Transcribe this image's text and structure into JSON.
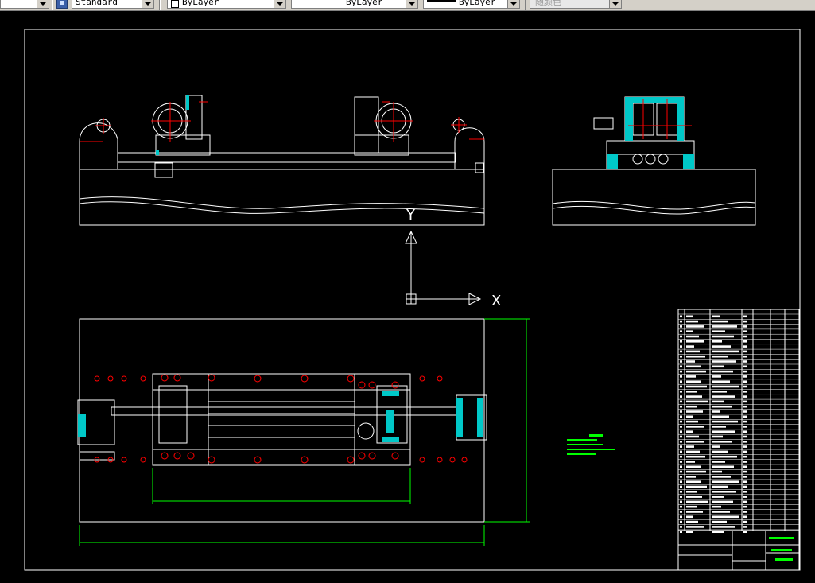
{
  "toolbar": {
    "text_style": "Standard",
    "layer": "ByLayer",
    "linetype": "ByLayer",
    "lineweight": "ByLayer",
    "plot_style": "随颜色"
  },
  "drawing": {
    "axis_x_label": "X",
    "axis_y_label": "Y",
    "colors": {
      "background": "#000000",
      "line": "#ffffff",
      "center": "#ff0000",
      "hatch": "#00c8c8",
      "dimension": "#00ff00"
    }
  }
}
